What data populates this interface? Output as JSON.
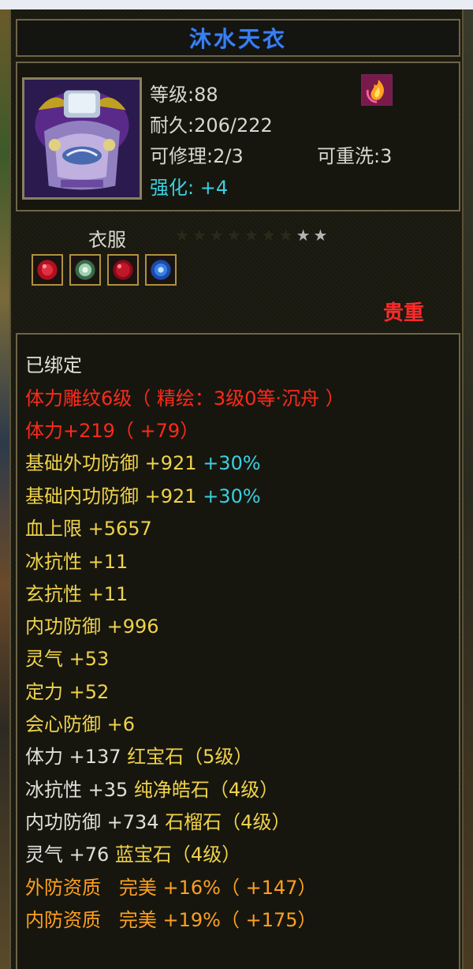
{
  "item": {
    "name": "沐水天衣",
    "level_label": "等级:88",
    "durability_label": "耐久:206/222",
    "repair_label": "可修理:2/3",
    "rewash_label": "可重洗:3",
    "enhance_prefix": "强化:",
    "enhance_value": "+4",
    "category": "衣服",
    "rarity": "贵重",
    "stars_total": 9,
    "stars_lit": 2,
    "gems": [
      "red-gem-icon",
      "green-gem-icon",
      "ruby-gem-icon",
      "blue-gem-icon"
    ]
  },
  "attributes": {
    "bound": "已绑定",
    "carve": "体力雕纹6级（ 精绘：3级0等·沉舟 ）",
    "stamina": "体力+219（ +79）",
    "ext_def_base": "基础外功防御 +921",
    "ext_def_pct": "+30%",
    "int_def_base": "基础内功防御 +921",
    "int_def_pct": "+30%",
    "hp_max": "血上限 +5657",
    "ice_res": "冰抗性 +11",
    "xuan_res": "玄抗性 +11",
    "int_def": "内功防御 +996",
    "spirit": "灵气 +53",
    "focus": "定力 +52",
    "crit_def": "会心防御 +6",
    "gem1_stat": "体力 +137",
    "gem1_name": "红宝石（5级）",
    "gem2_stat": "冰抗性 +35",
    "gem2_name": "纯净皓石（4级）",
    "gem3_stat": "内功防御 +734",
    "gem3_name": "石榴石（4级）",
    "gem4_stat": "灵气 +76",
    "gem4_name": "蓝宝石（4级）",
    "q1_label": "外防资质",
    "q1_grade": "完美",
    "q1_value": "+16%（ +147）",
    "q2_label": "内防资质",
    "q2_grade": "完美",
    "q2_value": "+19%（ +175）"
  },
  "colors": {
    "title": "#3a7ff0",
    "rarity": "#ff2a2a",
    "red_text": "#ff2a1a",
    "yellow_text": "#f0d24a",
    "cyan_text": "#3ad0e0",
    "orange_text": "#ffa020"
  }
}
